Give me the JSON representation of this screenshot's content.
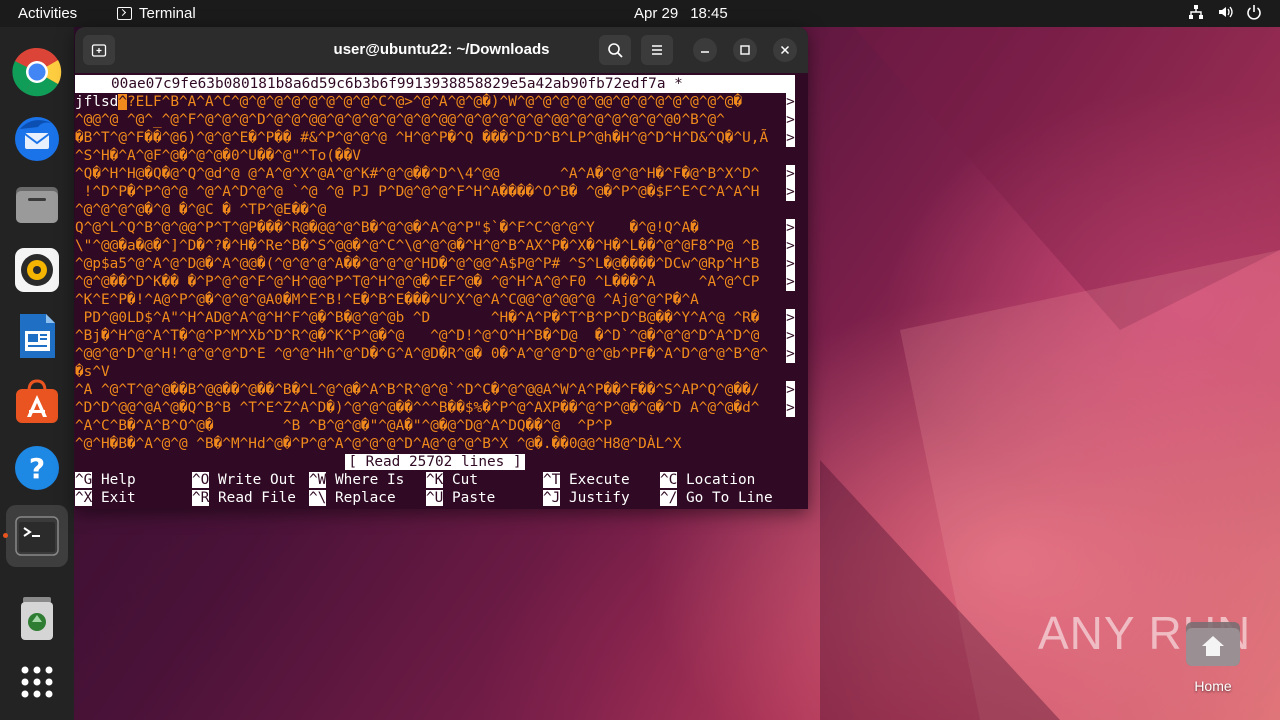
{
  "topbar": {
    "activities": "Activities",
    "app_name": "Terminal",
    "date": "Apr 29",
    "time": "18:45",
    "tray_icons": [
      "network-icon",
      "volume-icon",
      "power-icon"
    ]
  },
  "dock": {
    "items": [
      {
        "name": "chrome",
        "icon": "chrome-icon"
      },
      {
        "name": "thunderbird",
        "icon": "thunderbird-icon"
      },
      {
        "name": "files",
        "icon": "files-icon"
      },
      {
        "name": "rhythmbox",
        "icon": "rhythmbox-icon"
      },
      {
        "name": "libreoffice-writer",
        "icon": "writer-icon"
      },
      {
        "name": "app-center",
        "icon": "app-center-icon"
      },
      {
        "name": "help",
        "icon": "help-icon"
      },
      {
        "name": "terminal",
        "icon": "terminal-icon"
      },
      {
        "name": "trash",
        "icon": "trash-icon"
      },
      {
        "name": "show-apps",
        "icon": "app-grid-icon"
      }
    ]
  },
  "terminal": {
    "title": "user@ubuntu22: ~/Downloads",
    "nano_header": "00ae07c9fe63b080181b8a6d59c6b3b6f9913938858829e5a42ab90fb72edf7a *",
    "first_line_prefix": "jflsd",
    "cursor_char": "^",
    "first_line_rest": "?ELF^B^A^A^C^@^@^@^@^@^@^@^@^C^@>^@^A^@^@�)^W^@^@^@^@^@@^@^@^@^@^@^@^@�",
    "lines": [
      "^@@^@ ^@^_^@^F^@^@^@^D^@^@^@@^@^@^@^@^@^@^@@^@^@^@^@^@^@@^@^@^@^@^@^@0^B^@^",
      "�B^T^@^F��^@6)^@^@^E�^P�� #&^P^@^@^@ ^H^@^P�^Q ���^D^D^B^LP^@h�H^@^D^H^D&^Q�^U,Ã",
      "^S^H�^A^@F^@�^@^@�0^U��^@\"^To(��V",
      "^Q�^H^H@�Q�@^Q^@d^@ @^A^@^X^@A^@^K#^@^@��^D^\\4^@@       ^A^A�^@^@^H�^F�@^B^X^D^",
      " !^D^P�^P^@^@ ^@^A^D^@^@ `^@ ^@ PJ P^D@^@^@^F^H^A����^O^B� ^@�^P^@�$F^E^C^A^A^H",
      "^@^@^@^@�^@ �^@C � ^TP^@E��^@",
      "Q^@^L^Q^B^@^@@^P^T^@P���^R@�@@^@^B�^@^@�^A^@^P\"$`�^F^C^@^@^Y    �^@!Q^A�",
      "\\\"^@@�a�@�^]^D�^?�^H�^Re^B�^S^@@�^@^C^\\@^@^@�^H^@^B^AX^P�^X�^H�^L��^@^@F8^P@ ^B",
      "^@p$a5^@^A^@^D@�^A^@@�(^@^@^@^A��^@^@^@^HD�^@^@@^A$P@^P# ^S^L�@����^DCw^@Rp^H^B",
      "^@^@��^D^K�� �^P^@^@^F^@^H^@@^P^T@^H^@^@�^EF^@� ^@^H^A^@^F0 ^L���^A     ^A^@^CP",
      "^K^E^P�!^A@^P^@�^@^@^@A0�M^E^B!^E�^B^E���^U^X^@^A^C@@^@^@@^@ ^Aj@^@^P�^A",
      " PD^@0LD$^A\"^H^AD@^A^@^H^F^@�^B�@^@^@b ^D       ^H�^A^P�^T^B^P^D^B@��^Y^A^@ ^R�",
      "^Bj�^H^@^A^T�^@^P^M^Xb^D^R^@�^K^P^@�^@   ^@^D!^@^O^H^B�^D@  �^D`^@�^@^@^D^A^D^@",
      "^@@^@^D^@^H!^@^@^@^D^E ^@^@^Hh^@^D�^G^A^@D�R^@� 0�^A^@^@^D^@^@b^PF�^A^D^@^@^B^@^",
      "�s^V",
      "^A ^@^T^@^@��B^@@��^@��^B�^L^@^@�^A^B^R^@^@`^D^C�^@^@@A^W^A^P��^F��^S^AP^Q^@��/",
      "^D^D^@@^@A^@�Q^B^B ^T^E^Z^A^D�)^@^@^@��^^^B��$%�^P^@^AXP��^@^P^@�^@�^D A^@^@�d^",
      "^A^C^B�^A^B^O^@�        ^B ^B^@^@�\"^@A�\"^@�@^D@^A^DQ��^@  ^P^P",
      "^@^H�B�^A^@^@ ^B�^M^Hd^@�^P^@^A^@^@^@^D^A@^@^@^B^X ^@�.��0@@^H8@^DÀL^X"
    ],
    "more_marker": ">",
    "status": "[ Read 25702 lines ]",
    "shortcuts_row1": [
      {
        "key": "^G",
        "label": " Help"
      },
      {
        "key": "^O",
        "label": " Write Out"
      },
      {
        "key": "^W",
        "label": " Where Is"
      },
      {
        "key": "^K",
        "label": " Cut"
      },
      {
        "key": "^T",
        "label": " Execute"
      },
      {
        "key": "^C",
        "label": " Location"
      }
    ],
    "shortcuts_row2": [
      {
        "key": "^X",
        "label": " Exit"
      },
      {
        "key": "^R",
        "label": " Read File"
      },
      {
        "key": "^\\",
        "label": " Replace"
      },
      {
        "key": "^U",
        "label": " Paste"
      },
      {
        "key": "^J",
        "label": " Justify"
      },
      {
        "key": "^/",
        "label": " Go To Line"
      }
    ]
  },
  "desktop": {
    "home_label": "Home",
    "watermark": "ANY RUN"
  },
  "colors": {
    "terminal_bg": "#300a24",
    "binary_text": "#f08a1c",
    "accent": "#e95420"
  }
}
